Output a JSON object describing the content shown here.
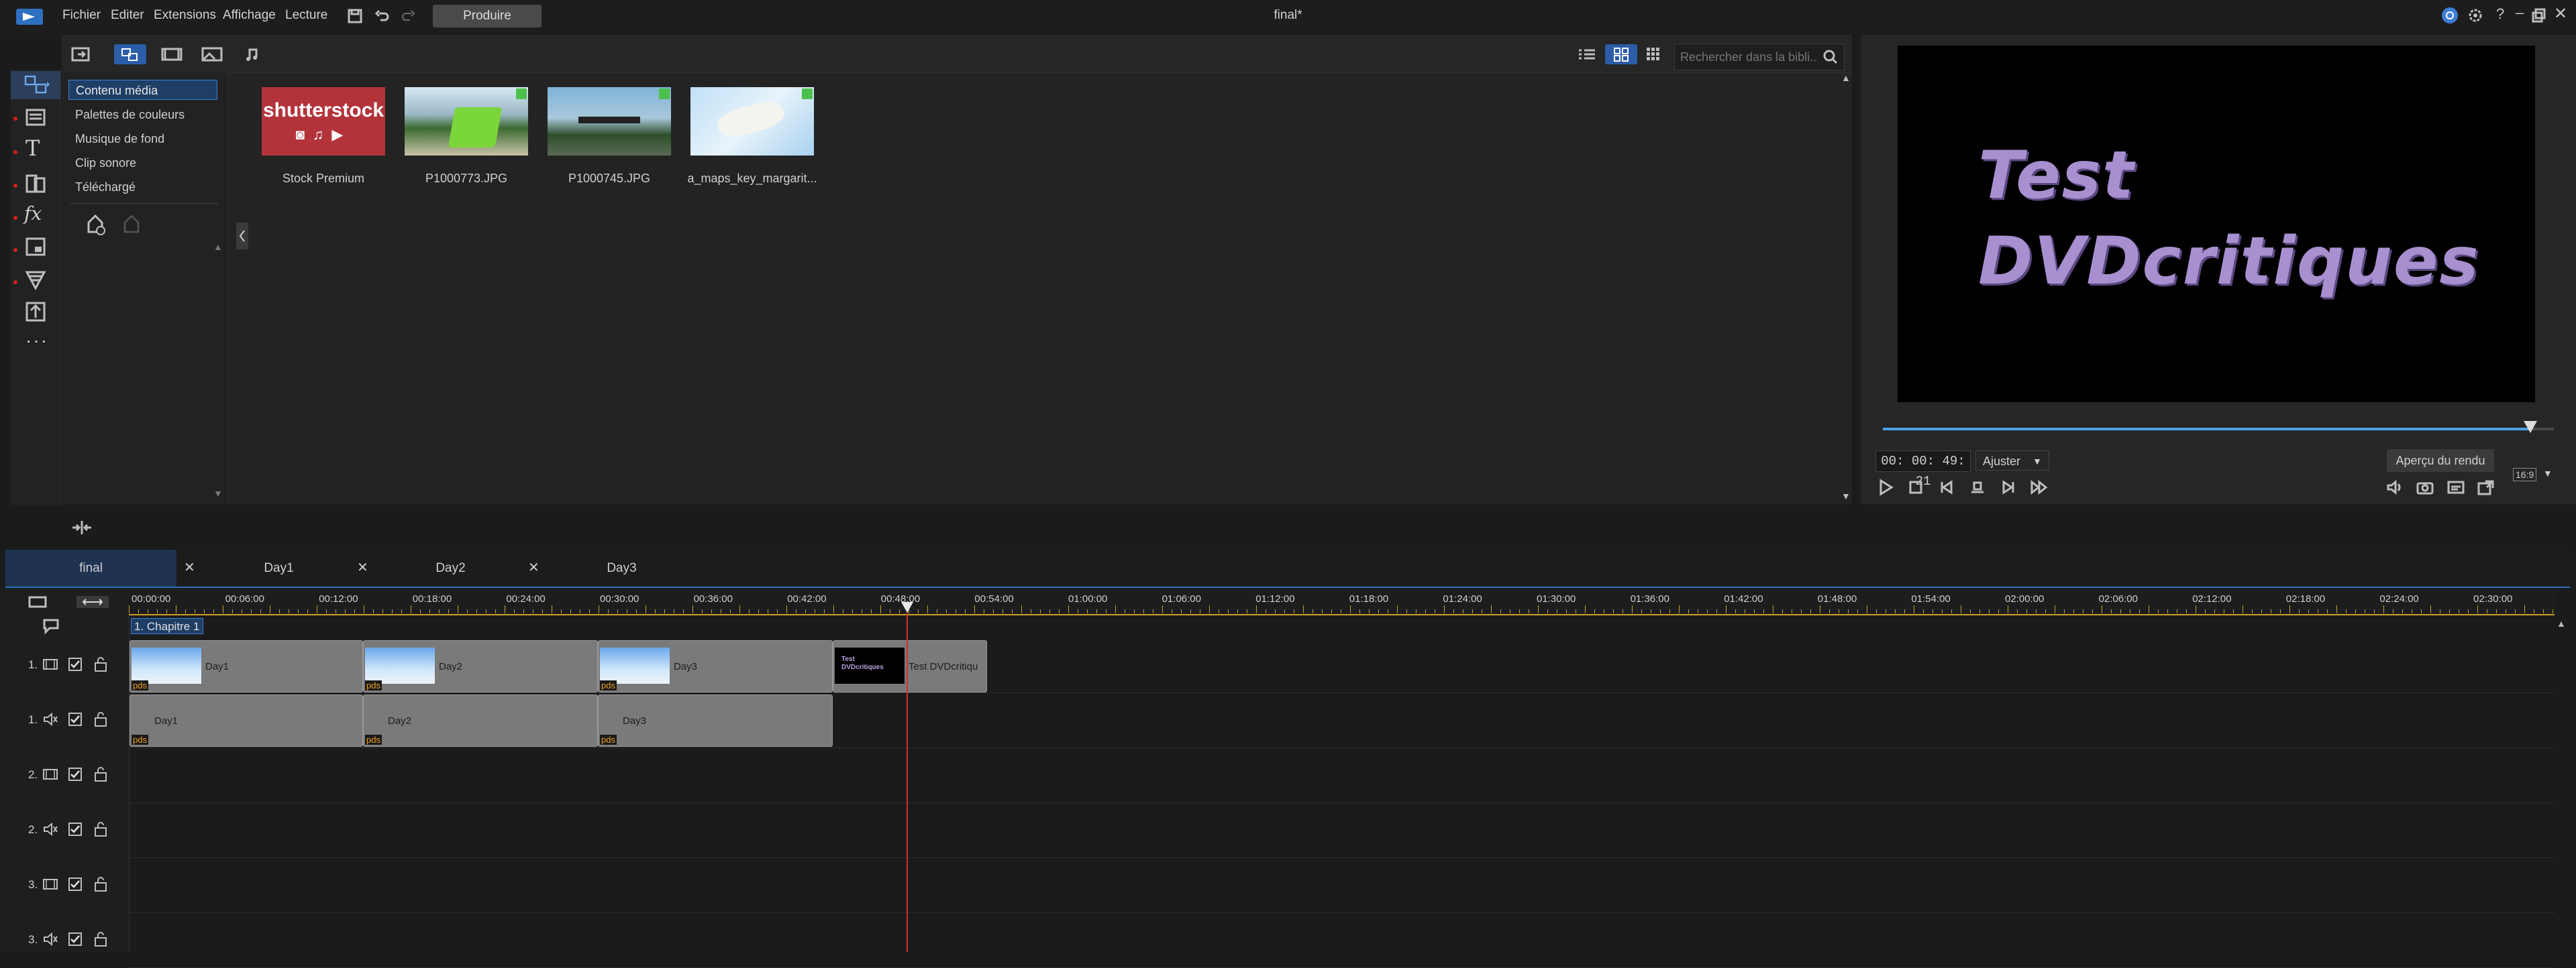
{
  "menu": {
    "items": [
      "Fichier",
      "Editer",
      "Extensions",
      "Affichage",
      "Lecture"
    ],
    "produce_label": "Produire",
    "window_title": "final*"
  },
  "library": {
    "categories": [
      "Contenu média",
      "Palettes de couleurs",
      "Musique de fond",
      "Clip sonore",
      "Téléchargé"
    ],
    "selected_category": 0,
    "search_placeholder": "Rechercher dans la bibli...",
    "media": [
      {
        "label": "Stock Premium",
        "thumb_text": "shutterstock",
        "checked": false
      },
      {
        "label": "P1000773.JPG",
        "checked": true
      },
      {
        "label": "P1000745.JPG",
        "checked": true
      },
      {
        "label": "a_maps_key_margarit...",
        "checked": true
      }
    ]
  },
  "preview": {
    "title_text": "Test\nDVDcritiques",
    "timecode": "00: 00: 49: 21",
    "zoom": "Ajuster",
    "render_label": "Aperçu du rendu",
    "ratio": "16:9",
    "progress": 0.965
  },
  "tabs": [
    {
      "label": "final",
      "active": true
    },
    {
      "label": "Day1",
      "active": false
    },
    {
      "label": "Day2",
      "active": false
    },
    {
      "label": "Day3",
      "active": false
    }
  ],
  "timeline": {
    "ruler": [
      "00:00:00",
      "00:06:00",
      "00:12:00",
      "00:18:00",
      "00:24:00",
      "00:30:00",
      "00:36:00",
      "00:42:00",
      "00:48:00",
      "00:54:00",
      "01:00:00",
      "01:06:00",
      "01:12:00",
      "01:18:00",
      "01:24:00",
      "01:30:00",
      "01:36:00",
      "01:42:00",
      "01:48:00",
      "01:54:00",
      "02:00:00",
      "02:06:00",
      "02:12:00",
      "02:18:00",
      "02:24:00",
      "02:30:00"
    ],
    "chapter": "1. Chapitre 1",
    "tracks": [
      "1.",
      "1.",
      "2.",
      "2.",
      "3.",
      "3."
    ],
    "video_clips": [
      {
        "name": "Day1",
        "pds": "pds"
      },
      {
        "name": "Day2",
        "pds": "pds"
      },
      {
        "name": "Day3",
        "pds": "pds"
      },
      {
        "name": "Test DVDcritiqu",
        "thumb_text": "Test\nDVDcritiques"
      }
    ],
    "audio_clips": [
      {
        "name": "Day1",
        "pds": "pds"
      },
      {
        "name": "Day2",
        "pds": "pds"
      },
      {
        "name": "Day3",
        "pds": "pds"
      }
    ]
  }
}
